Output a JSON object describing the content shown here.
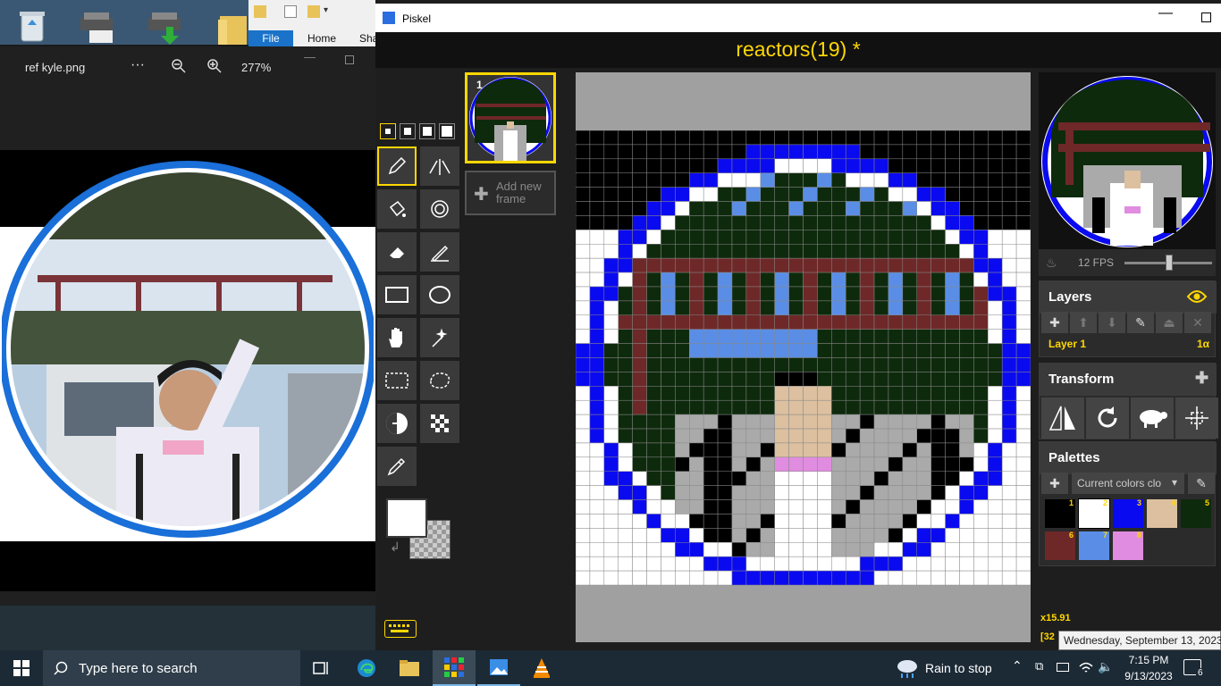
{
  "photos": {
    "filename": "ref kyle.png",
    "more": "···",
    "zoom": "277%"
  },
  "explorer": {
    "tabs": [
      "File",
      "Home",
      "Sha"
    ]
  },
  "piskel": {
    "app_title": "Piskel",
    "project_title": "reactors(19) *",
    "frame_number": "1",
    "add_frame": "Add new frame",
    "fps": "12 FPS",
    "fps_value": 12,
    "layers_title": "Layers",
    "layer_name": "Layer 1",
    "layer_opacity": "1α",
    "transform_title": "Transform",
    "palettes_title": "Palettes",
    "palette_select": "Current colors clo",
    "palette": [
      {
        "num": "1",
        "color": "#000000"
      },
      {
        "num": "2",
        "color": "#ffffff"
      },
      {
        "num": "3",
        "color": "#0a0af0"
      },
      {
        "num": "4",
        "color": "#dcc0a0"
      },
      {
        "num": "5",
        "color": "#0e2a0c"
      },
      {
        "num": "6",
        "color": "#6e2828"
      },
      {
        "num": "7",
        "color": "#5a8ee6"
      },
      {
        "num": "8",
        "color": "#e08ce0"
      }
    ],
    "cursor_x": "x15.91",
    "cursor_extra": "[32"
  },
  "taskbar": {
    "search_placeholder": "Type here to search",
    "weather": "Rain to stop",
    "time": "7:15 PM",
    "date": "9/13/2023",
    "notifications": "6",
    "tooltip": "Wednesday, September 13, 2023"
  }
}
